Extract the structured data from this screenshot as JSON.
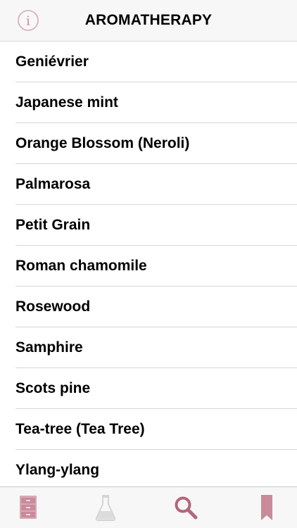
{
  "header": {
    "title": "AROMATHERAPY",
    "info_icon": "info-icon"
  },
  "colors": {
    "accent": "#b5657a",
    "accent_light": "#d9a9b5",
    "inactive": "#cfcfcf"
  },
  "list": {
    "items": [
      {
        "label": "Geniévrier"
      },
      {
        "label": "Japanese mint"
      },
      {
        "label": "Orange Blossom (Neroli)"
      },
      {
        "label": "Palmarosa"
      },
      {
        "label": "Petit Grain"
      },
      {
        "label": "Roman chamomile"
      },
      {
        "label": "Rosewood"
      },
      {
        "label": "Samphire"
      },
      {
        "label": "Scots pine"
      },
      {
        "label": "Tea-tree (Tea Tree)"
      },
      {
        "label": "Ylang-ylang"
      }
    ]
  },
  "tabbar": {
    "tabs": [
      {
        "icon": "cabinet-icon",
        "active": false
      },
      {
        "icon": "flask-icon",
        "active": false
      },
      {
        "icon": "search-icon",
        "active": true
      },
      {
        "icon": "bookmark-icon",
        "active": false
      }
    ]
  }
}
